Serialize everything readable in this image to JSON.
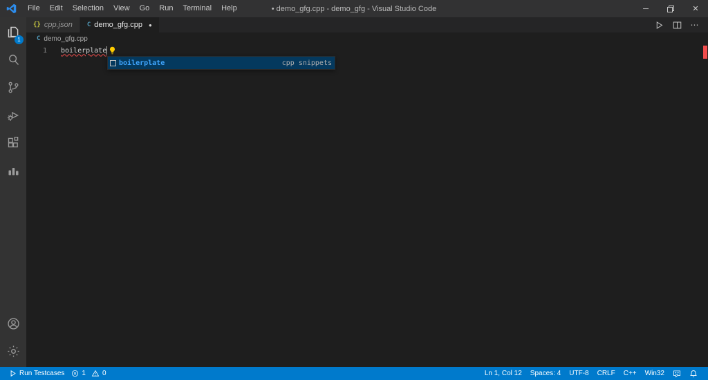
{
  "colors": {
    "accent": "#007acc",
    "titlebar_bg": "#323233",
    "activitybar_bg": "#333333",
    "editor_bg": "#1e1e1e",
    "tabbar_bg": "#252526",
    "inactive_tab_bg": "#2d2d2d",
    "statusbar_bg": "#007acc",
    "error_red": "#f14c4c",
    "suggest_selected_bg": "#04395e",
    "suggest_match_blue": "#40a6ff",
    "json_icon_yellow": "#cbcb41",
    "cpp_icon_blue": "#519aba",
    "lightbulb_yellow": "#ffcc00"
  },
  "title_bar": {
    "menus": [
      "File",
      "Edit",
      "Selection",
      "View",
      "Go",
      "Run",
      "Terminal",
      "Help"
    ],
    "window_title": "• demo_gfg.cpp - demo_gfg - Visual Studio Code",
    "glyphs": {
      "minimize": "─",
      "close": "✕"
    }
  },
  "activity_bar": {
    "explorer_badge": "1",
    "items": [
      "explorer",
      "search",
      "source-control",
      "run-and-debug",
      "extensions",
      "testcase-results",
      "account",
      "settings"
    ]
  },
  "tabs": [
    {
      "label": "cpp.json",
      "icon_glyph": "{}",
      "preview": true
    },
    {
      "label": "demo_gfg.cpp",
      "icon_glyph": "C",
      "modified_indicator": "●"
    }
  ],
  "editor_actions": {
    "more_glyph": "⋯"
  },
  "breadcrumb": {
    "file": "demo_gfg.cpp",
    "icon_glyph": "C"
  },
  "editor": {
    "line_number": "1",
    "code": "boilerplate",
    "suggest": {
      "label": "boilerplate",
      "detail": "cpp snippets"
    }
  },
  "status_bar": {
    "run_testcases": "Run Testcases",
    "errors": "1",
    "warnings": "0",
    "cursor_position": "Ln 1, Col 12",
    "indentation": "Spaces: 4",
    "encoding": "UTF-8",
    "eol": "CRLF",
    "language": "C++",
    "platform": "Win32"
  }
}
